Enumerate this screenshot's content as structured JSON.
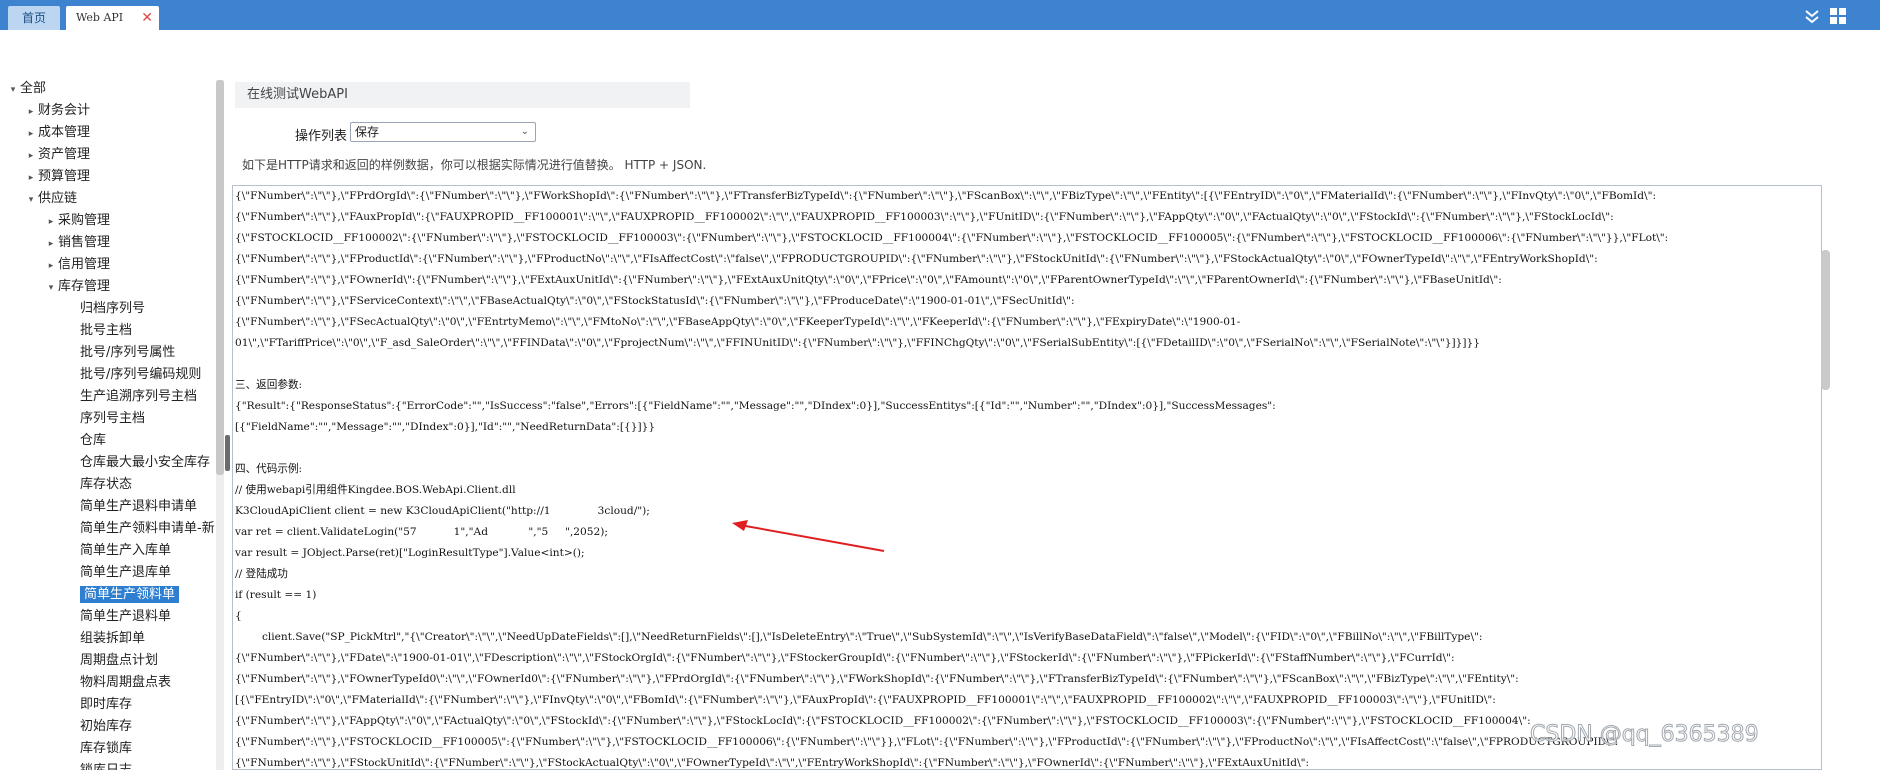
{
  "tabs": {
    "home": "首页",
    "webapi": "Web API",
    "close": "✕"
  },
  "tree": [
    {
      "label": "全部",
      "level": 0,
      "arrow": "▾"
    },
    {
      "label": "财务会计",
      "level": 1,
      "arrow": "▸"
    },
    {
      "label": "成本管理",
      "level": 1,
      "arrow": "▸"
    },
    {
      "label": "资产管理",
      "level": 1,
      "arrow": "▸"
    },
    {
      "label": "预算管理",
      "level": 1,
      "arrow": "▸"
    },
    {
      "label": "供应链",
      "level": 1,
      "arrow": "▾"
    },
    {
      "label": "采购管理",
      "level": 2,
      "arrow": "▸"
    },
    {
      "label": "销售管理",
      "level": 2,
      "arrow": "▸"
    },
    {
      "label": "信用管理",
      "level": 2,
      "arrow": "▸"
    },
    {
      "label": "库存管理",
      "level": 2,
      "arrow": "▾"
    },
    {
      "label": "归档序列号",
      "level": 3,
      "arrow": ""
    },
    {
      "label": "批号主档",
      "level": 3,
      "arrow": ""
    },
    {
      "label": "批号/序列号属性",
      "level": 3,
      "arrow": ""
    },
    {
      "label": "批号/序列号编码规则",
      "level": 3,
      "arrow": ""
    },
    {
      "label": "生产追溯序列号主档",
      "level": 3,
      "arrow": ""
    },
    {
      "label": "序列号主档",
      "level": 3,
      "arrow": ""
    },
    {
      "label": "仓库",
      "level": 3,
      "arrow": ""
    },
    {
      "label": "仓库最大最小安全库存",
      "level": 3,
      "arrow": ""
    },
    {
      "label": "库存状态",
      "level": 3,
      "arrow": ""
    },
    {
      "label": "简单生产退料申请单",
      "level": 3,
      "arrow": ""
    },
    {
      "label": "简单生产领料申请单-新",
      "level": 3,
      "arrow": ""
    },
    {
      "label": "简单生产入库单",
      "level": 3,
      "arrow": ""
    },
    {
      "label": "简单生产退库单",
      "level": 3,
      "arrow": ""
    },
    {
      "label": "简单生产领料单",
      "level": 3,
      "arrow": "",
      "selected": true
    },
    {
      "label": "简单生产退料单",
      "level": 3,
      "arrow": ""
    },
    {
      "label": "组装拆卸单",
      "level": 3,
      "arrow": ""
    },
    {
      "label": "周期盘点计划",
      "level": 3,
      "arrow": ""
    },
    {
      "label": "物料周期盘点表",
      "level": 3,
      "arrow": ""
    },
    {
      "label": "即时库存",
      "level": 3,
      "arrow": ""
    },
    {
      "label": "初始库存",
      "level": 3,
      "arrow": ""
    },
    {
      "label": "库存锁库",
      "level": 3,
      "arrow": ""
    },
    {
      "label": "锁库日志",
      "level": 3,
      "arrow": ""
    }
  ],
  "panel": {
    "title": "在线测试WebAPI",
    "op_label": "操作列表",
    "op_value": "保存",
    "hint": "如下是HTTP请求和返回的样例数据，你可以根据实际情况进行值替换。 HTTP + JSON."
  },
  "code_lines": [
    "{\\\"FNumber\\\":\\\"\\\"},\\\"FPrdOrgId\\\":{\\\"FNumber\\\":\\\"\\\"},\\\"FWorkShopId\\\":{\\\"FNumber\\\":\\\"\\\"},\\\"FTransferBizTypeId\\\":{\\\"FNumber\\\":\\\"\\\"},\\\"FScanBox\\\":\\\"\\\",\\\"FBizType\\\":\\\"\\\",\\\"FEntity\\\":[{\\\"FEntryID\\\":\\\"0\\\",\\\"FMaterialId\\\":{\\\"FNumber\\\":\\\"\\\"},\\\"FInvQty\\\":\\\"0\\\",\\\"FBomId\\\":",
    "{\\\"FNumber\\\":\\\"\\\"},\\\"FAuxPropId\\\":{\\\"FAUXPROPID__FF100001\\\":\\\"\\\",\\\"FAUXPROPID__FF100002\\\":\\\"\\\",\\\"FAUXPROPID__FF100003\\\":\\\"\\\"},\\\"FUnitID\\\":{\\\"FNumber\\\":\\\"\\\"},\\\"FAppQty\\\":\\\"0\\\",\\\"FActualQty\\\":\\\"0\\\",\\\"FStockId\\\":{\\\"FNumber\\\":\\\"\\\"},\\\"FStockLocId\\\":",
    "{\\\"FSTOCKLOCID__FF100002\\\":{\\\"FNumber\\\":\\\"\\\"},\\\"FSTOCKLOCID__FF100003\\\":{\\\"FNumber\\\":\\\"\\\"},\\\"FSTOCKLOCID__FF100004\\\":{\\\"FNumber\\\":\\\"\\\"},\\\"FSTOCKLOCID__FF100005\\\":{\\\"FNumber\\\":\\\"\\\"},\\\"FSTOCKLOCID__FF100006\\\":{\\\"FNumber\\\":\\\"\\\"}},\\\"FLot\\\":",
    "{\\\"FNumber\\\":\\\"\\\"},\\\"FProductId\\\":{\\\"FNumber\\\":\\\"\\\"},\\\"FProductNo\\\":\\\"\\\",\\\"FIsAffectCost\\\":\\\"false\\\",\\\"FPRODUCTGROUPID\\\":{\\\"FNumber\\\":\\\"\\\"},\\\"FStockUnitId\\\":{\\\"FNumber\\\":\\\"\\\"},\\\"FStockActualQty\\\":\\\"0\\\",\\\"FOwnerTypeId\\\":\\\"\\\",\\\"FEntryWorkShopId\\\":",
    "{\\\"FNumber\\\":\\\"\\\"},\\\"FOwnerId\\\":{\\\"FNumber\\\":\\\"\\\"},\\\"FExtAuxUnitId\\\":{\\\"FNumber\\\":\\\"\\\"},\\\"FExtAuxUnitQty\\\":\\\"0\\\",\\\"FPrice\\\":\\\"0\\\",\\\"FAmount\\\":\\\"0\\\",\\\"FParentOwnerTypeId\\\":\\\"\\\",\\\"FParentOwnerId\\\":{\\\"FNumber\\\":\\\"\\\"},\\\"FBaseUnitId\\\":",
    "{\\\"FNumber\\\":\\\"\\\"},\\\"FServiceContext\\\":\\\"\\\",\\\"FBaseActualQty\\\":\\\"0\\\",\\\"FStockStatusId\\\":{\\\"FNumber\\\":\\\"\\\"},\\\"FProduceDate\\\":\\\"1900-01-01\\\",\\\"FSecUnitId\\\":",
    "{\\\"FNumber\\\":\\\"\\\"},\\\"FSecActualQty\\\":\\\"0\\\",\\\"FEntrtyMemo\\\":\\\"\\\",\\\"FMtoNo\\\":\\\"\\\",\\\"FBaseAppQty\\\":\\\"0\\\",\\\"FKeeperTypeId\\\":\\\"\\\",\\\"FKeeperId\\\":{\\\"FNumber\\\":\\\"\\\"},\\\"FExpiryDate\\\":\\\"1900-01-",
    "01\\\",\\\"FTariffPrice\\\":\\\"0\\\",\\\"F_asd_SaleOrder\\\":\\\"\\\",\\\"FFINData\\\":\\\"0\\\",\\\"FprojectNum\\\":\\\"\\\",\\\"FFINUnitID\\\":{\\\"FNumber\\\":\\\"\\\"},\\\"FFINChgQty\\\":\\\"0\\\",\\\"FSerialSubEntity\\\":[{\\\"FDetailID\\\":\\\"0\\\",\\\"FSerialNo\\\":\\\"\\\",\\\"FSerialNote\\\":\\\"\\\"}]}]}}",
    "",
    "三、返回参数:",
    "{\"Result\":{\"ResponseStatus\":{\"ErrorCode\":\"\",\"IsSuccess\":\"false\",\"Errors\":[{\"FieldName\":\"\",\"Message\":\"\",\"DIndex\":0}],\"SuccessEntitys\":[{\"Id\":\"\",\"Number\":\"\",\"DIndex\":0}],\"SuccessMessages\":",
    "[{\"FieldName\":\"\",\"Message\":\"\",\"DIndex\":0}],\"Id\":\"\",\"NeedReturnData\":[{}]}}",
    "",
    "四、代码示例:",
    "// 使用webapi引用组件Kingdee.BOS.WebApi.Client.dll",
    "K3CloudApiClient client = new K3CloudApiClient(\"http://1              3cloud/\");",
    "var ret = client.ValidateLogin(\"57           1\",\"Ad            \",\"5     \",2052);",
    "var result = JObject.Parse(ret)[\"LoginResultType\"].Value<int>();",
    "// 登陆成功",
    "if (result == 1)",
    "{",
    "        client.Save(\"SP_PickMtrl\",\"{\\\"Creator\\\":\\\"\\\",\\\"NeedUpDateFields\\\":[],\\\"NeedReturnFields\\\":[],\\\"IsDeleteEntry\\\":\\\"True\\\",\\\"SubSystemId\\\":\\\"\\\",\\\"IsVerifyBaseDataField\\\":\\\"false\\\",\\\"Model\\\":{\\\"FID\\\":\\\"0\\\",\\\"FBillNo\\\":\\\"\\\",\\\"FBillType\\\":",
    "{\\\"FNumber\\\":\\\"\\\"},\\\"FDate\\\":\\\"1900-01-01\\\",\\\"FDescription\\\":\\\"\\\",\\\"FStockOrgId\\\":{\\\"FNumber\\\":\\\"\\\"},\\\"FStockerGroupId\\\":{\\\"FNumber\\\":\\\"\\\"},\\\"FStockerId\\\":{\\\"FNumber\\\":\\\"\\\"},\\\"FPickerId\\\":{\\\"FStaffNumber\\\":\\\"\\\"},\\\"FCurrId\\\":",
    "{\\\"FNumber\\\":\\\"\\\"},\\\"FOwnerTypeId0\\\":\\\"\\\",\\\"FOwnerId0\\\":{\\\"FNumber\\\":\\\"\\\"},\\\"FPrdOrgId\\\":{\\\"FNumber\\\":\\\"\\\"},\\\"FWorkShopId\\\":{\\\"FNumber\\\":\\\"\\\"},\\\"FTransferBizTypeId\\\":{\\\"FNumber\\\":\\\"\\\"},\\\"FScanBox\\\":\\\"\\\",\\\"FBizType\\\":\\\"\\\",\\\"FEntity\\\":",
    "[{\\\"FEntryID\\\":\\\"0\\\",\\\"FMaterialId\\\":{\\\"FNumber\\\":\\\"\\\"},\\\"FInvQty\\\":\\\"0\\\",\\\"FBomId\\\":{\\\"FNumber\\\":\\\"\\\"},\\\"FAuxPropId\\\":{\\\"FAUXPROPID__FF100001\\\":\\\"\\\",\\\"FAUXPROPID__FF100002\\\":\\\"\\\",\\\"FAUXPROPID__FF100003\\\":\\\"\\\"},\\\"FUnitID\\\":",
    "{\\\"FNumber\\\":\\\"\\\"},\\\"FAppQty\\\":\\\"0\\\",\\\"FActualQty\\\":\\\"0\\\",\\\"FStockId\\\":{\\\"FNumber\\\":\\\"\\\"},\\\"FStockLocId\\\":{\\\"FSTOCKLOCID__FF100002\\\":{\\\"FNumber\\\":\\\"\\\"},\\\"FSTOCKLOCID__FF100003\\\":{\\\"FNumber\\\":\\\"\\\"},\\\"FSTOCKLOCID__FF100004\\\":",
    "{\\\"FNumber\\\":\\\"\\\"},\\\"FSTOCKLOCID__FF100005\\\":{\\\"FNumber\\\":\\\"\\\"},\\\"FSTOCKLOCID__FF100006\\\":{\\\"FNumber\\\":\\\"\\\"}},\\\"FLot\\\":{\\\"FNumber\\\":\\\"\\\"},\\\"FProductId\\\":{\\\"FNumber\\\":\\\"\\\"},\\\"FProductNo\\\":\\\"\\\",\\\"FIsAffectCost\\\":\\\"false\\\",\\\"FPRODUCTGROUPID\\\":",
    "{\\\"FNumber\\\":\\\"\\\"},\\\"FStockUnitId\\\":{\\\"FNumber\\\":\\\"\\\"},\\\"FStockActualQty\\\":\\\"0\\\",\\\"FOwnerTypeId\\\":\\\"\\\",\\\"FEntryWorkShopId\\\":{\\\"FNumber\\\":\\\"\\\"},\\\"FOwnerId\\\":{\\\"FNumber\\\":\\\"\\\"},\\\"FExtAuxUnitId\\\":"
  ],
  "watermark": "CSDN @qq_6365389",
  "colors": {
    "topbar": "#3d83d0",
    "selected": "#2f7fd0",
    "annotation_arrow": "#e02020"
  },
  "icons": {
    "collapse": "double-chevron-down-icon",
    "grid": "grid-icon"
  }
}
